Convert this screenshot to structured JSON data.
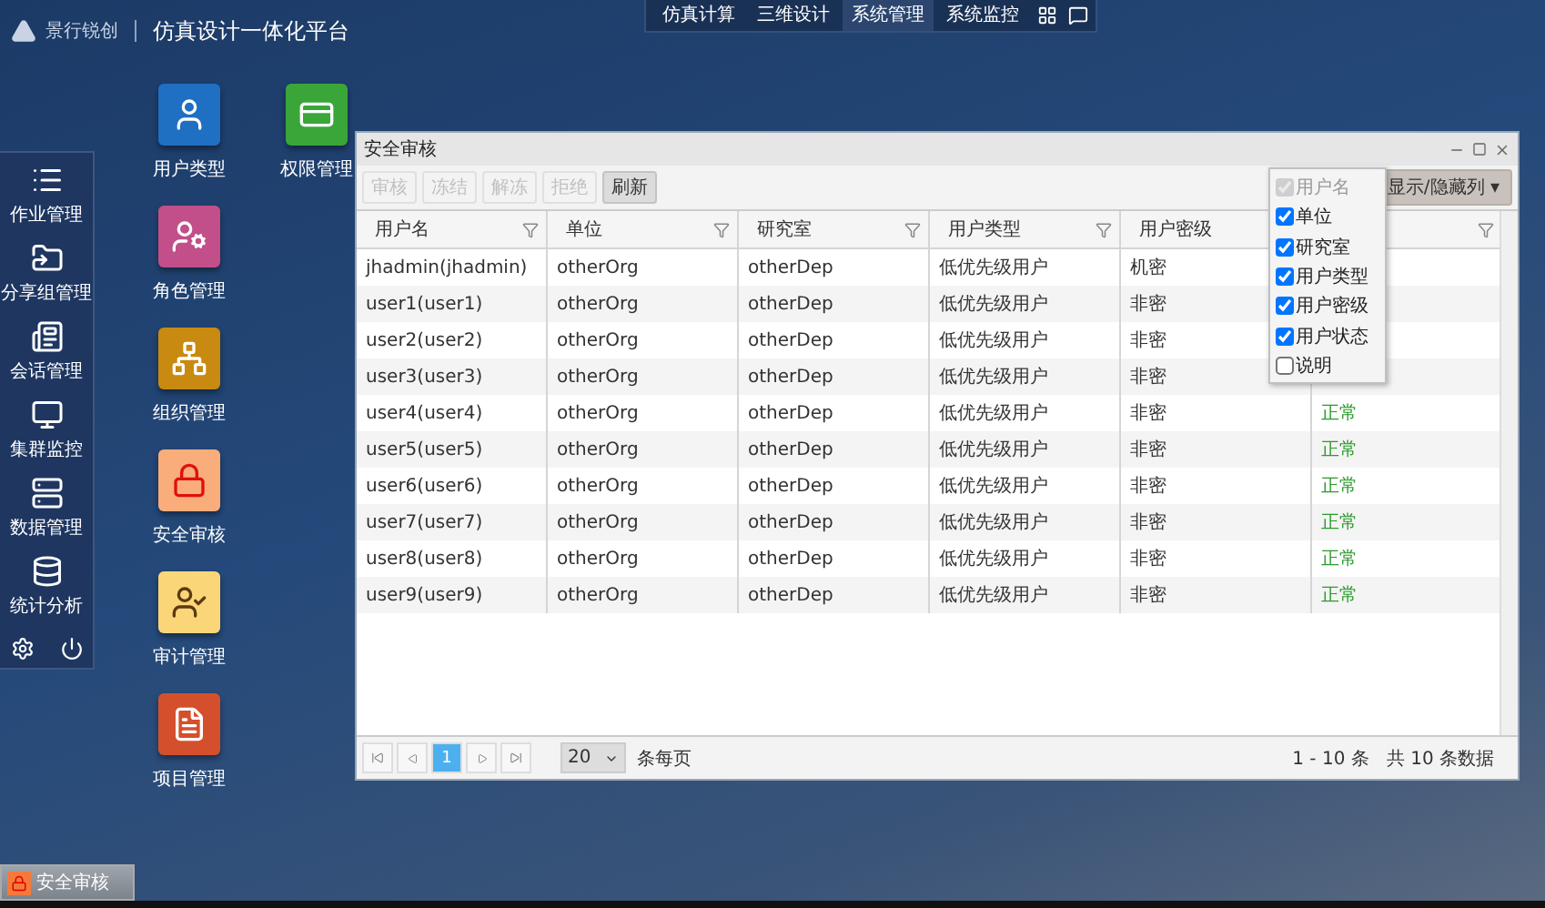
{
  "header": {
    "logo_text": "景行锐创",
    "platform_title": "仿真设计一体化平台"
  },
  "top_nav": [
    {
      "label": "仿真计算",
      "selected": false
    },
    {
      "label": "三维设计",
      "selected": false
    },
    {
      "label": "系统管理",
      "selected": true
    },
    {
      "label": "系统监控",
      "selected": false
    }
  ],
  "sidebar": {
    "items": [
      {
        "label": "作业管理",
        "kind": "list"
      },
      {
        "label": "分享组管理",
        "kind": "share"
      },
      {
        "label": "会话管理",
        "kind": "news"
      },
      {
        "label": "集群监控",
        "kind": "monitor"
      },
      {
        "label": "数据管理",
        "kind": "server"
      },
      {
        "label": "统计分析",
        "kind": "database"
      }
    ]
  },
  "desktop_icons": [
    [
      {
        "label": "用户类型",
        "kind": "user"
      },
      {
        "label": "角色管理",
        "kind": "role"
      },
      {
        "label": "组织管理",
        "kind": "org"
      },
      {
        "label": "安全审核",
        "kind": "lock"
      },
      {
        "label": "审计管理",
        "kind": "audit"
      },
      {
        "label": "项目管理",
        "kind": "project"
      }
    ],
    [
      {
        "label": "权限管理",
        "kind": "permission"
      }
    ]
  ],
  "window": {
    "title": "安全审核",
    "toolbar": [
      {
        "label": "审核",
        "disabled": true
      },
      {
        "label": "冻结",
        "disabled": true
      },
      {
        "label": "解冻",
        "disabled": true
      },
      {
        "label": "拒绝",
        "disabled": true
      },
      {
        "label": "刷新",
        "disabled": false
      }
    ],
    "columns_button": "显示/隐藏列 ▾",
    "columns": [
      {
        "label": "用户名",
        "kind": "text"
      },
      {
        "label": "单位",
        "kind": "text"
      },
      {
        "label": "研究室",
        "kind": "text"
      },
      {
        "label": "用户类型",
        "kind": "text"
      },
      {
        "label": "用户密级",
        "kind": "text"
      },
      {
        "kind": "status"
      }
    ],
    "rows": [
      [
        "jhadmin(jhadmin)",
        "otherOrg",
        "otherDep",
        "低优先级用户",
        "机密"
      ],
      [
        "user1(user1)",
        "otherOrg",
        "otherDep",
        "低优先级用户",
        "非密"
      ],
      [
        "user2(user2)",
        "otherOrg",
        "otherDep",
        "低优先级用户",
        "非密"
      ],
      [
        "user3(user3)",
        "otherOrg",
        "otherDep",
        "低优先级用户",
        "非密"
      ],
      [
        "user4(user4)",
        "otherOrg",
        "otherDep",
        "低优先级用户",
        "非密",
        "正常"
      ],
      [
        "user5(user5)",
        "otherOrg",
        "otherDep",
        "低优先级用户",
        "非密",
        "正常"
      ],
      [
        "user6(user6)",
        "otherOrg",
        "otherDep",
        "低优先级用户",
        "非密",
        "正常"
      ],
      [
        "user7(user7)",
        "otherOrg",
        "otherDep",
        "低优先级用户",
        "非密",
        "正常"
      ],
      [
        "user8(user8)",
        "otherOrg",
        "otherDep",
        "低优先级用户",
        "非密",
        "正常"
      ],
      [
        "user9(user9)",
        "otherOrg",
        "otherDep",
        "低优先级用户",
        "非密",
        "正常"
      ]
    ],
    "column_menu": [
      {
        "label": "用户名",
        "checked": true,
        "disabled": true
      },
      {
        "label": "单位",
        "checked": true,
        "disabled": false
      },
      {
        "label": "研究室",
        "checked": true,
        "disabled": false
      },
      {
        "label": "用户类型",
        "checked": true,
        "disabled": false
      },
      {
        "label": "用户密级",
        "checked": true,
        "disabled": false
      },
      {
        "label": "用户状态",
        "checked": true,
        "disabled": false
      },
      {
        "label": "说明",
        "checked": false,
        "disabled": false
      }
    ],
    "pager": {
      "pages": [
        {
          "label": "1",
          "selected": true
        }
      ],
      "page_size": "20",
      "per_page_label": "条每页",
      "range": "1 - 10 条",
      "total": "共 10 条数据"
    }
  },
  "taskbar": {
    "items": [
      {
        "label": "安全审核",
        "kind": "lock"
      }
    ]
  }
}
